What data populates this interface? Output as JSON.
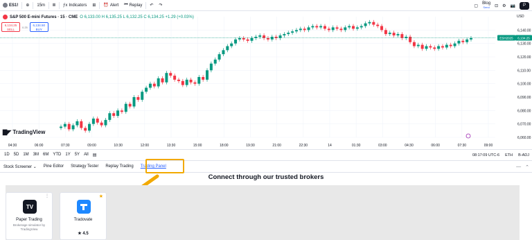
{
  "toolbar": {
    "symbol": "ES1!",
    "interval": "15m",
    "indicators": "Indicators",
    "alert": "Alert",
    "replay": "Replay",
    "blog": "Blog",
    "blog_sub": "Send",
    "publish": "P"
  },
  "legend": {
    "title": "S&P 500 E-mini Futures · 15 · CME",
    "values": "O 6,133.00 H 6,135.25 L 6,132.25 C 6,134.25 +1.29 (+0.03%)"
  },
  "trade": {
    "sell_price": "6,134.25",
    "sell_label": "SELL",
    "spread": "0.25",
    "buy_price": "6,134.50",
    "buy_label": "BUY"
  },
  "tv_logo": "TradingView",
  "chart_data": {
    "type": "candlestick",
    "currency": "USD",
    "last_label": "ESH2025",
    "last_price": "6,134.25",
    "ylim": [
      6060,
      6150
    ],
    "y_ticks": [
      "6,140.00",
      "6,130.00",
      "6,120.00",
      "6,110.00",
      "6,100.00",
      "6,090.00",
      "6,080.00",
      "6,070.00",
      "6,060.00"
    ],
    "x_ticks": [
      "04:30",
      "06:00",
      "07:30",
      "09:00",
      "10:30",
      "12:00",
      "13:30",
      "15:00",
      "18:00",
      "19:30",
      "21:00",
      "22:30",
      "14",
      "01:30",
      "03:00",
      "04:30",
      "06:00",
      "07:30",
      "09:00"
    ],
    "candles_close": [
      6068,
      6070,
      6066,
      6069,
      6072,
      6067,
      6065,
      6070,
      6074,
      6071,
      6069,
      6073,
      6078,
      6076,
      6080,
      6079,
      6085,
      6083,
      6090,
      6088,
      6094,
      6097,
      6100,
      6098,
      6104,
      6101,
      6108,
      6106,
      6103,
      6102,
      6099,
      6103,
      6101,
      6100,
      6105,
      6103,
      6110,
      6115,
      6118,
      6122,
      6125,
      6128,
      6130,
      6133,
      6134,
      6133,
      6132,
      6134,
      6135,
      6136,
      6134,
      6133,
      6135,
      6134,
      6136,
      6137,
      6138,
      6139,
      6140,
      6141,
      6140,
      6142,
      6143,
      6142,
      6143,
      6141,
      6140,
      6142,
      6141,
      6140,
      6142,
      6143,
      6141,
      6142,
      6143,
      6145,
      6146,
      6144,
      6143,
      6140,
      6137,
      6138,
      6136,
      6137,
      6134,
      6135,
      6131,
      6128,
      6129,
      6126,
      6128,
      6127,
      6126,
      6128,
      6127,
      6129,
      6128,
      6130,
      6132,
      6131,
      6133,
      6134
    ]
  },
  "timeframes": [
    "1D",
    "5D",
    "1M",
    "3M",
    "6M",
    "YTD",
    "1Y",
    "5Y",
    "All"
  ],
  "status": {
    "time": "08:17:09 UTC-6",
    "session": "ETH",
    "adj": "B-ADJ"
  },
  "tabs": [
    "Stock Screener",
    "Pine Editor",
    "Strategy Tester",
    "Replay Trading",
    "Trading Panel"
  ],
  "panel": {
    "heading": "Connect through our trusted brokers",
    "brokers": [
      {
        "name": "Paper Trading",
        "sub": "Brokerage simulator by TradingView"
      },
      {
        "name": "Tradovate",
        "rating": "★ 4.5"
      }
    ]
  },
  "colors": {
    "up": "#089981",
    "down": "#f23645",
    "accent": "#2962ff",
    "highlight": "#f2a900"
  }
}
